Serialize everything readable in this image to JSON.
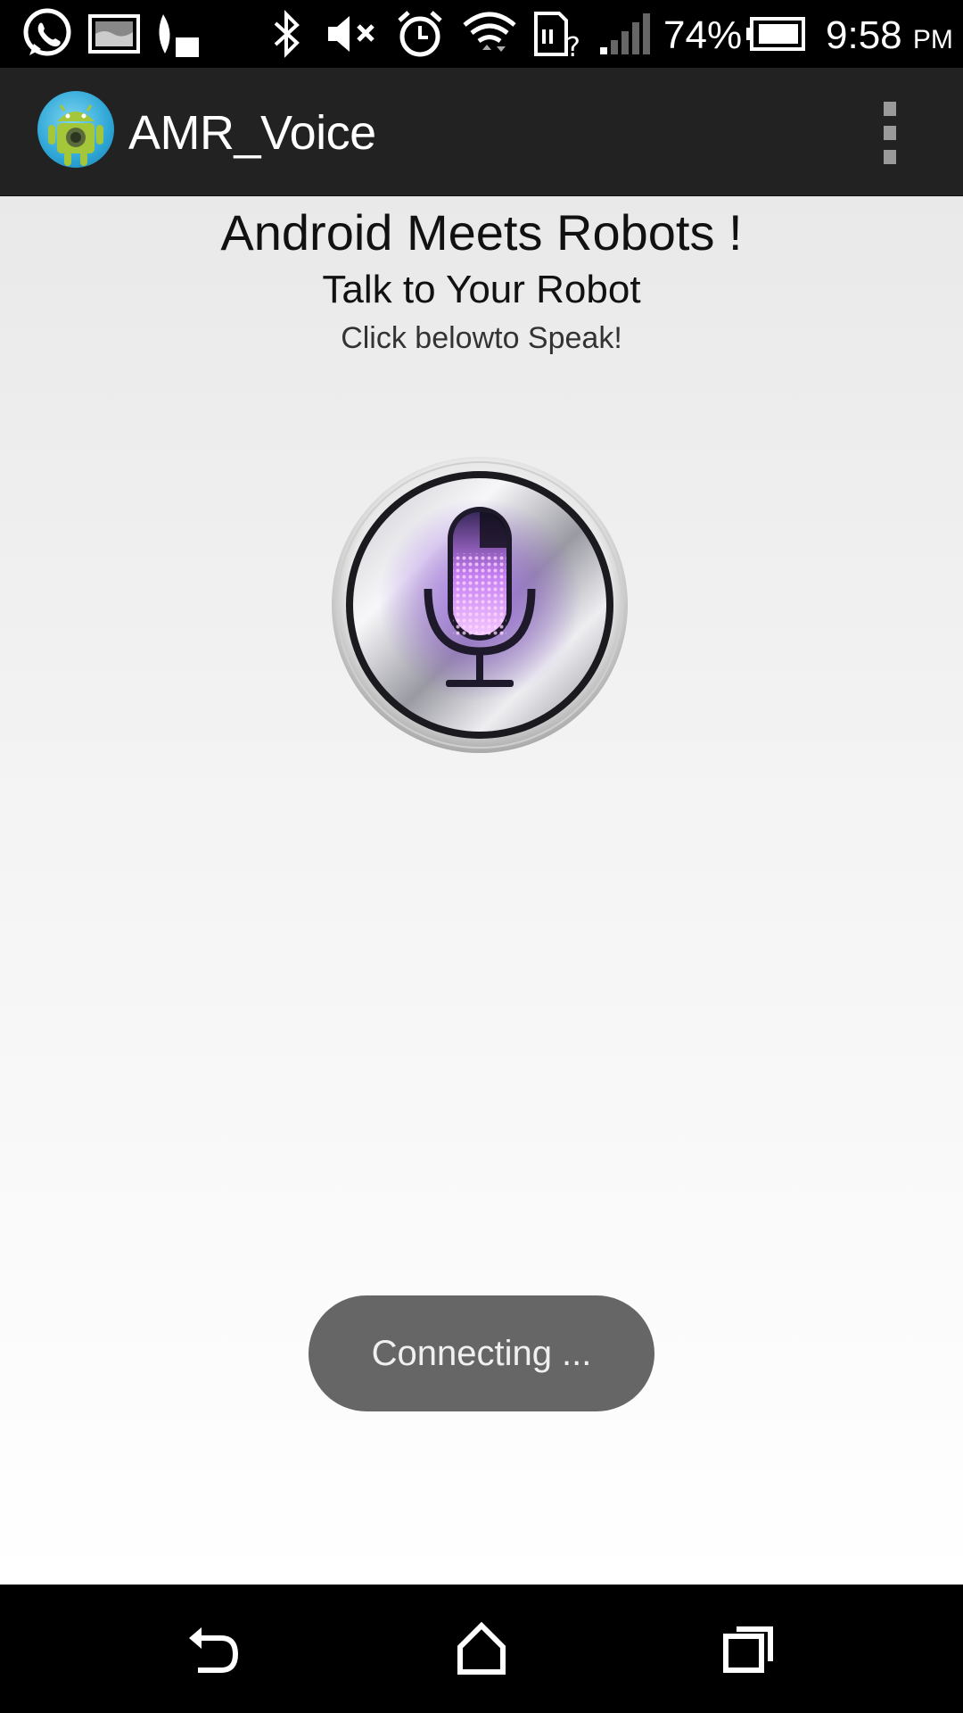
{
  "status_bar": {
    "battery_percent": "74%",
    "time": "9:58",
    "ampm": "PM",
    "icons": [
      "whatsapp-icon",
      "gallery-icon",
      "leaf-icon",
      "bluetooth-icon",
      "mute-icon",
      "alarm-icon",
      "wifi-icon",
      "sim-unknown-icon",
      "signal-icon",
      "battery-icon"
    ]
  },
  "action_bar": {
    "title": "AMR_Voice",
    "app_icon": "android-robot-icon",
    "menu_icon": "overflow-menu-icon"
  },
  "main": {
    "headline": "Android Meets Robots !",
    "subheadline": "Talk to Your Robot",
    "hint": "Click belowto Speak!",
    "mic_icon": "microphone-icon"
  },
  "toast": {
    "text": "Connecting ..."
  },
  "nav_bar": {
    "icons": [
      "back-icon",
      "home-icon",
      "recents-icon"
    ]
  },
  "colors": {
    "action_bar": "#222222",
    "toast": "#666666",
    "mic_glow": "#8a4fd6"
  }
}
